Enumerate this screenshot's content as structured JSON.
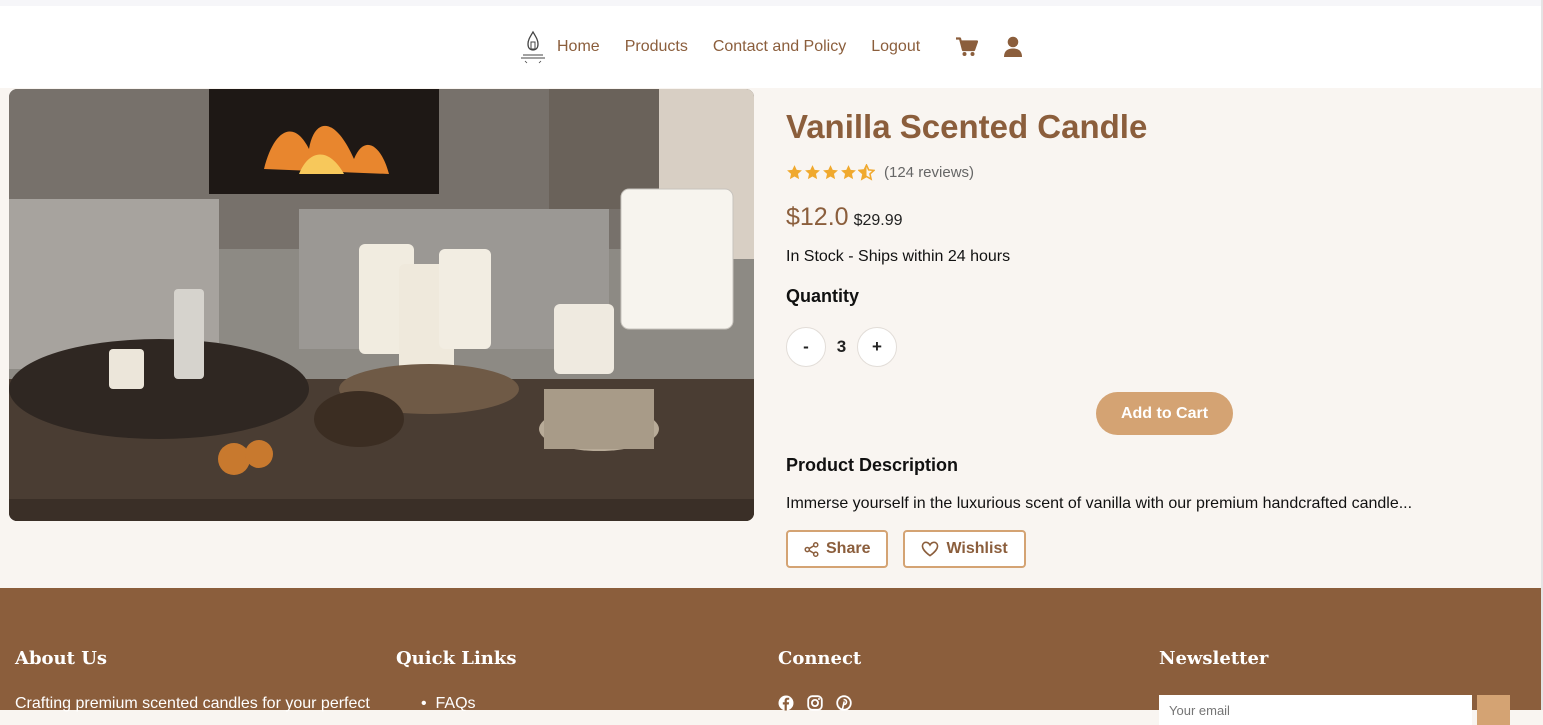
{
  "nav": {
    "logo": "candle-logo-icon",
    "links": [
      {
        "label": "Home"
      },
      {
        "label": "Products"
      },
      {
        "label": "Contact and Policy"
      },
      {
        "label": "Logout"
      }
    ],
    "icons": [
      "cart-icon",
      "user-icon"
    ]
  },
  "product": {
    "title": "Vanilla Scented Candle",
    "rating": 4.5,
    "reviews": "(124 reviews)",
    "price": "$12.0",
    "old_price": "$29.99",
    "stock": "In Stock - Ships within 24 hours",
    "quantity_label": "Quantity",
    "decrement_label": "-",
    "quantity": "3",
    "increment_label": "+",
    "add_to_cart": "Add to Cart",
    "description_title": "Product Description",
    "description": "Immerse yourself in the luxurious scent of vanilla with our premium handcrafted candle...",
    "share_label": "Share",
    "wishlist_label": "Wishlist"
  },
  "footer": {
    "about": {
      "title": "About Us",
      "text": "Crafting premium scented candles for your perfect"
    },
    "quick_links": {
      "title": "Quick Links",
      "items": [
        "FAQs"
      ]
    },
    "connect": {
      "title": "Connect",
      "icons": [
        "facebook-icon",
        "instagram-icon",
        "pinterest-icon"
      ]
    },
    "newsletter": {
      "title": "Newsletter",
      "placeholder": "Your email"
    }
  },
  "colors": {
    "brand": "#8b5e3c",
    "accent": "#d4a373",
    "star": "#f0a92e",
    "background": "#f9f5f1"
  }
}
